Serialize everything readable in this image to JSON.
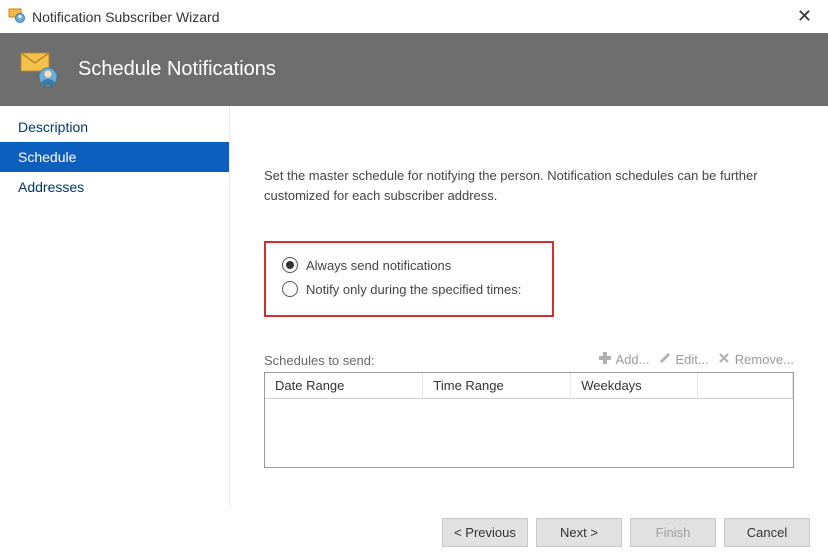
{
  "window": {
    "title": "Notification Subscriber Wizard"
  },
  "header": {
    "title": "Schedule Notifications"
  },
  "sidebar": {
    "items": [
      {
        "label": "Description"
      },
      {
        "label": "Schedule"
      },
      {
        "label": "Addresses"
      }
    ]
  },
  "main": {
    "description": "Set the master schedule for notifying the person. Notification schedules can be further customized for each subscriber address.",
    "radio_always": "Always send notifications",
    "radio_specified": "Notify only during the specified times:",
    "schedules_label": "Schedules to send:",
    "actions": {
      "add": "Add...",
      "edit": "Edit...",
      "remove": "Remove..."
    },
    "table": {
      "col_date": "Date Range",
      "col_time": "Time Range",
      "col_week": "Weekdays"
    }
  },
  "footer": {
    "previous": "< Previous",
    "next": "Next >",
    "finish": "Finish",
    "cancel": "Cancel"
  }
}
